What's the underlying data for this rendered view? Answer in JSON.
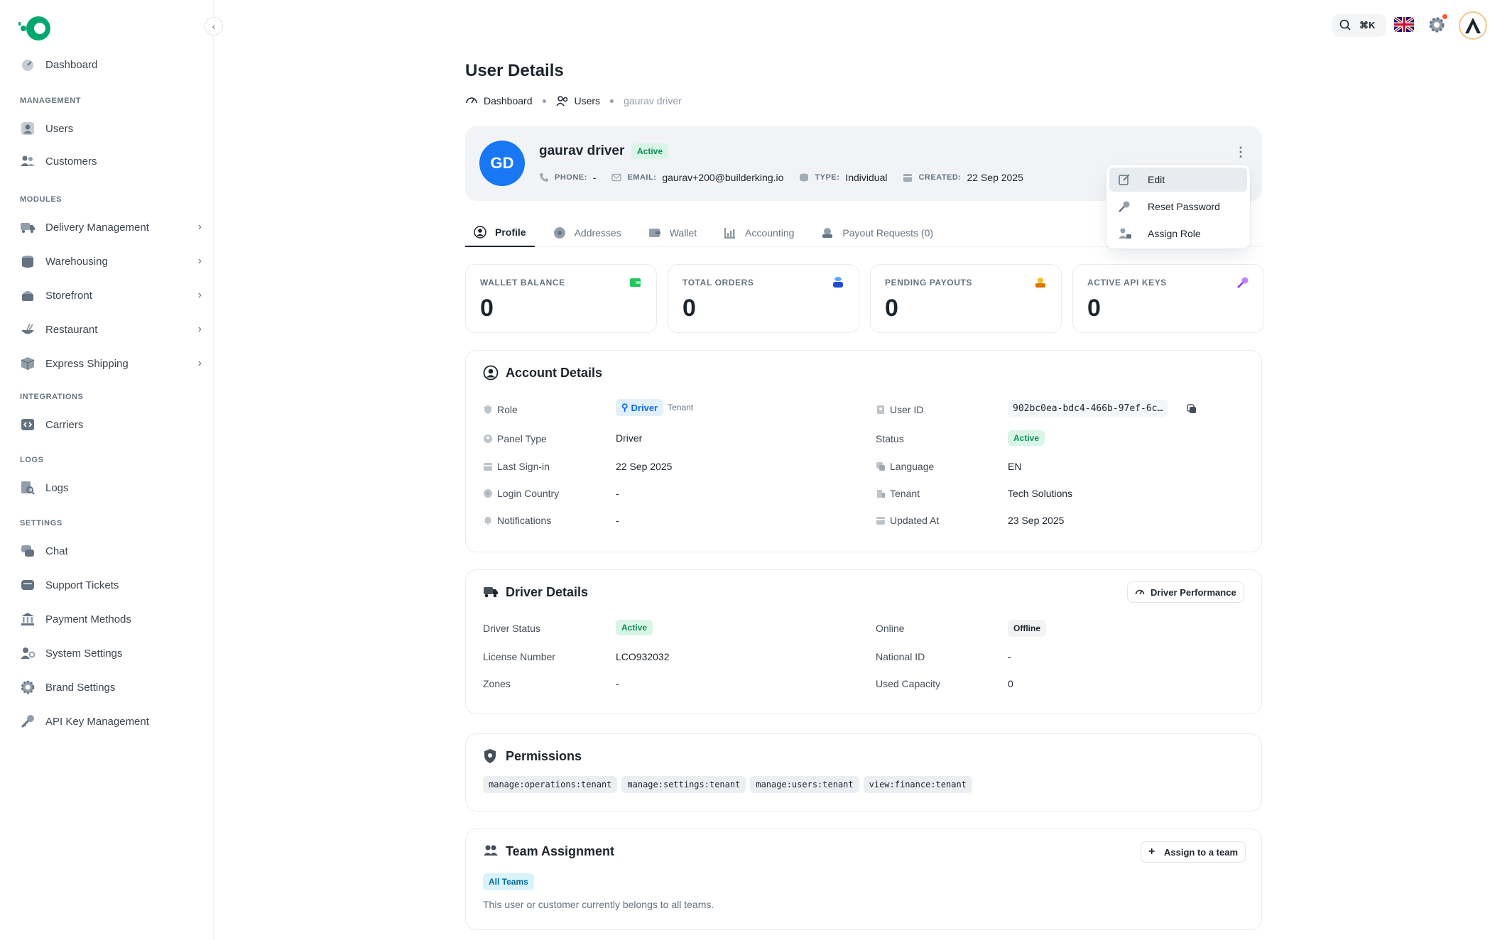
{
  "sidebar": {
    "dashboard": "Dashboard",
    "sections": {
      "management": "MANAGEMENT",
      "modules": "MODULES",
      "integrations": "INTEGRATIONS",
      "logs": "LOGS",
      "settings": "SETTINGS"
    },
    "items": {
      "users": "Users",
      "customers": "Customers",
      "delivery": "Delivery Management",
      "warehousing": "Warehousing",
      "storefront": "Storefront",
      "restaurant": "Restaurant",
      "express": "Express Shipping",
      "carriers": "Carriers",
      "logs": "Logs",
      "chat": "Chat",
      "support": "Support Tickets",
      "payment": "Payment Methods",
      "system": "System Settings",
      "brand": "Brand Settings",
      "apikey": "API Key Management"
    }
  },
  "topbar": {
    "shortcut": "⌘K"
  },
  "page": {
    "title": "User Details",
    "breadcrumb": [
      "Dashboard",
      "Users",
      "gaurav driver"
    ]
  },
  "user": {
    "initials": "GD",
    "name": "gaurav driver",
    "status": "Active",
    "phone_label": "PHONE:",
    "phone": "-",
    "email_label": "EMAIL:",
    "email": "gaurav+200@builderking.io",
    "type_label": "TYPE:",
    "type": "Individual",
    "created_label": "CREATED:",
    "created": "22 Sep 2025"
  },
  "menu": {
    "edit": "Edit",
    "reset": "Reset Password",
    "assign": "Assign Role"
  },
  "tabs": [
    "Profile",
    "Addresses",
    "Wallet",
    "Accounting",
    "Payout Requests (0)"
  ],
  "stats": [
    {
      "label": "WALLET BALANCE",
      "value": "0"
    },
    {
      "label": "TOTAL ORDERS",
      "value": "0"
    },
    {
      "label": "PENDING PAYOUTS",
      "value": "0"
    },
    {
      "label": "ACTIVE API KEYS",
      "value": "0"
    }
  ],
  "account": {
    "title": "Account Details",
    "role_label": "Role",
    "role": "Driver",
    "role_scope": "Tenant",
    "panel_label": "Panel Type",
    "panel": "Driver",
    "signin_label": "Last Sign-in",
    "signin": "22 Sep 2025",
    "country_label": "Login Country",
    "country": "-",
    "notif_label": "Notifications",
    "notif": "-",
    "userid_label": "User ID",
    "userid": "902bc0ea-bdc4-466b-97ef-6c…",
    "status_label": "Status",
    "status": "Active",
    "lang_label": "Language",
    "lang": "EN",
    "tenant_label": "Tenant",
    "tenant": "Tech Solutions",
    "updated_label": "Updated At",
    "updated": "23 Sep 2025"
  },
  "driver": {
    "title": "Driver Details",
    "perf_btn": "Driver Performance",
    "status_label": "Driver Status",
    "status": "Active",
    "license_label": "License Number",
    "license": "LCO932032",
    "zones_label": "Zones",
    "zones": "-",
    "online_label": "Online",
    "online": "Offline",
    "national_label": "National ID",
    "national": "-",
    "capacity_label": "Used Capacity",
    "capacity": "0"
  },
  "permissions": {
    "title": "Permissions",
    "items": [
      "manage:operations:tenant",
      "manage:settings:tenant",
      "manage:users:tenant",
      "view:finance:tenant"
    ]
  },
  "team": {
    "title": "Team Assignment",
    "btn": "Assign to a team",
    "chip": "All Teams",
    "desc": "This user or customer currently belongs to all teams."
  }
}
